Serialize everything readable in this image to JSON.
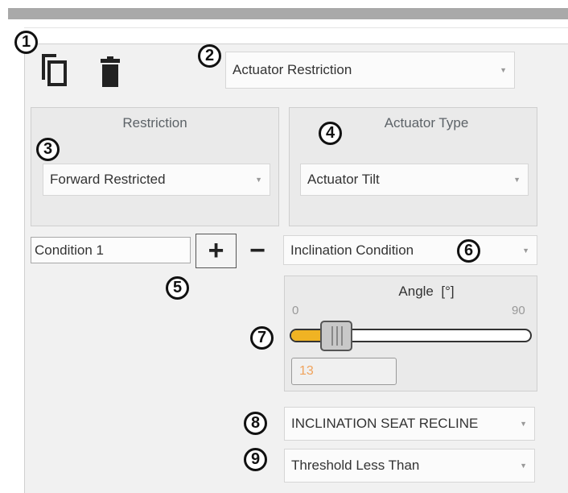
{
  "toolbar": {
    "copy_icon": "copy-icon",
    "delete_icon": "trash-icon"
  },
  "restriction_type_select": {
    "value": "Actuator Restriction"
  },
  "restriction_group": {
    "title": "Restriction",
    "select_value": "Forward Restricted"
  },
  "actuator_type_group": {
    "title": "Actuator Type",
    "select_value": "Actuator Tilt"
  },
  "condition": {
    "name_value": "Condition 1",
    "add_label": "+",
    "remove_label": "−",
    "type_value": "Inclination Condition"
  },
  "angle": {
    "title": "Angle",
    "unit": "[°]",
    "min_label": "0",
    "max_label": "90",
    "value": "13",
    "accent_color": "#f0b323"
  },
  "sensor_select": {
    "value": "INCLINATION SEAT RECLINE"
  },
  "threshold_select": {
    "value": "Threshold Less Than"
  },
  "callouts": [
    "1",
    "2",
    "3",
    "4",
    "5",
    "6",
    "7",
    "8",
    "9"
  ]
}
